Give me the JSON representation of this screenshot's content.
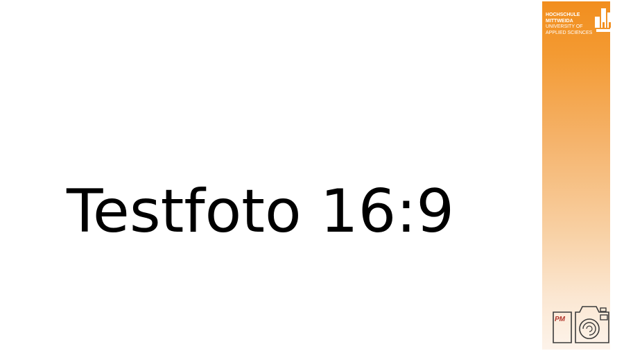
{
  "slide": {
    "title": "Testfoto 16:9"
  },
  "branding": {
    "university_line1": "HOCHSCHULE",
    "university_line2": "MITTWEIDA",
    "university_line3": "UNIVERSITY OF",
    "university_line4": "APPLIED SCIENCES",
    "university_icon": "university-building-logo",
    "camera_logo_text": "PM",
    "camera_icon": "camera-logo-icon",
    "accent_color": "#f28e1e"
  }
}
